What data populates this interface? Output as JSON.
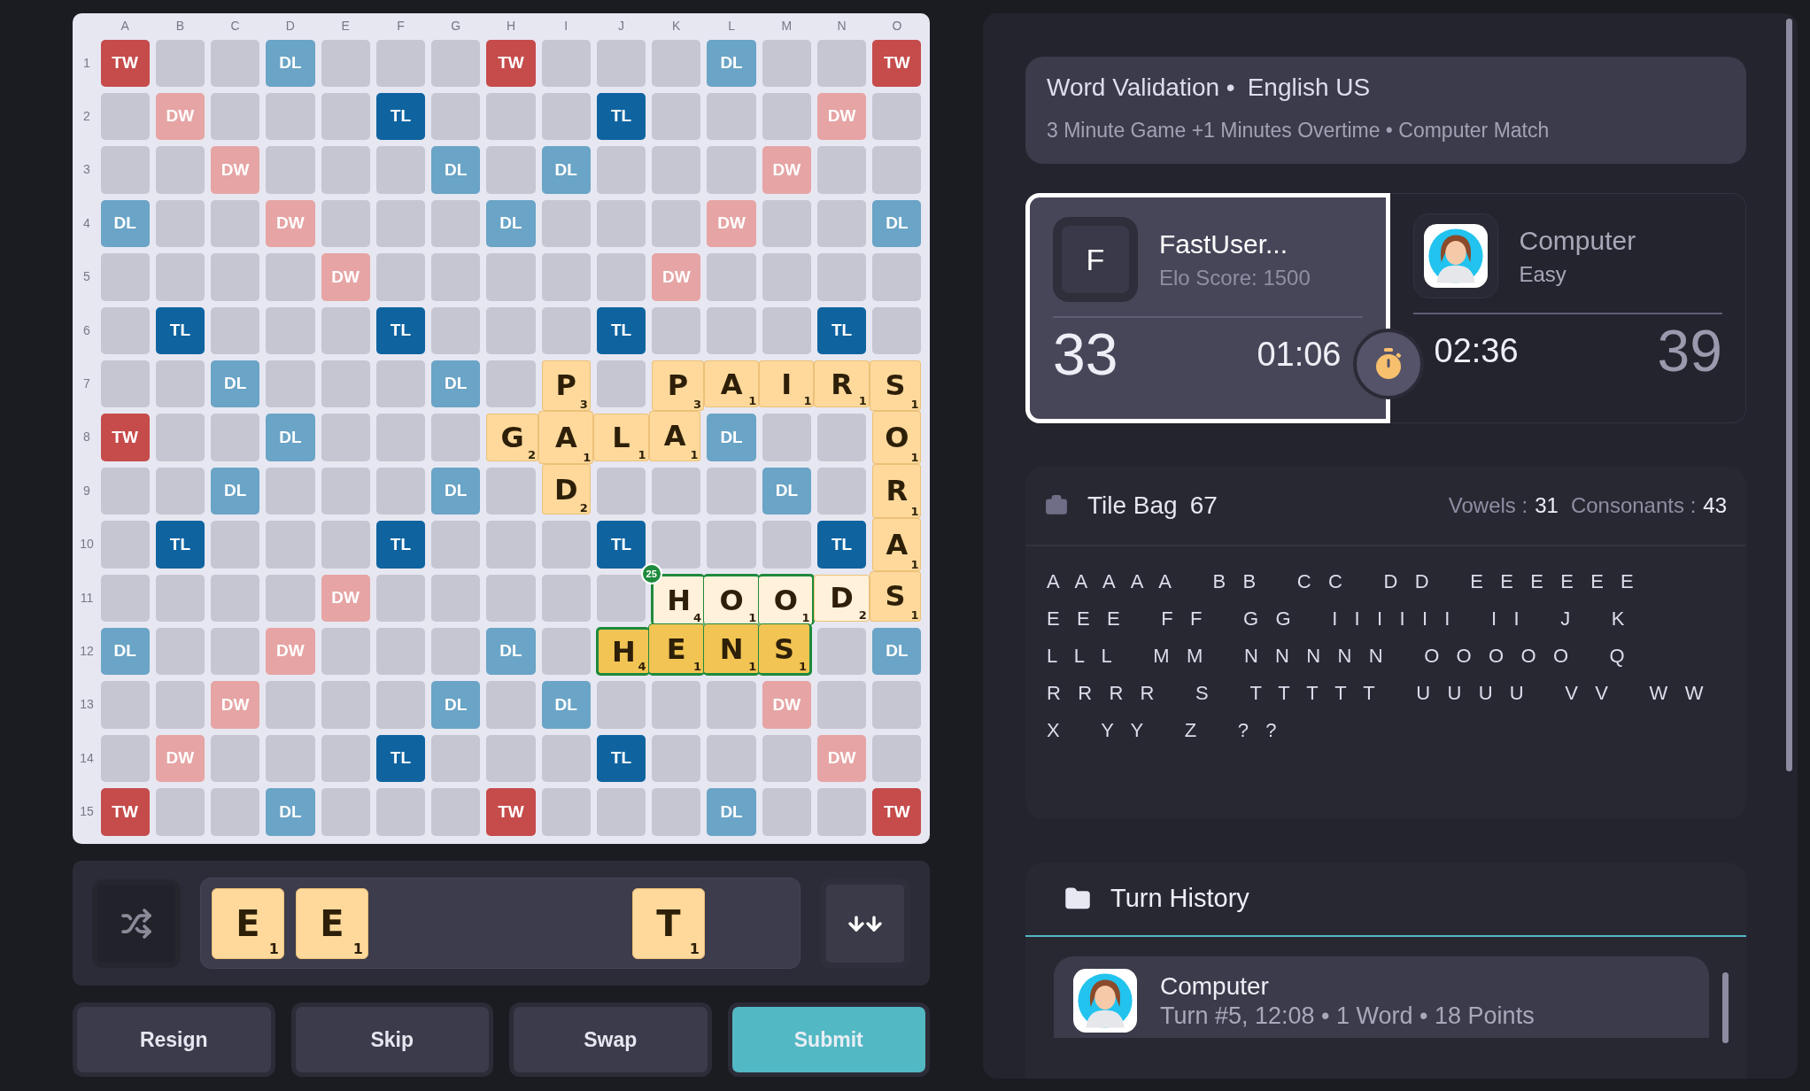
{
  "board": {
    "columns": [
      "A",
      "B",
      "C",
      "D",
      "E",
      "F",
      "G",
      "H",
      "I",
      "J",
      "K",
      "L",
      "M",
      "N",
      "O"
    ],
    "rows": [
      {
        "label": "1",
        "cells": [
          {
            "kind": "tw",
            "label": "TW"
          },
          {
            "kind": "empty"
          },
          {
            "kind": "empty"
          },
          {
            "kind": "dl",
            "label": "DL"
          },
          {
            "kind": "empty"
          },
          {
            "kind": "empty"
          },
          {
            "kind": "empty"
          },
          {
            "kind": "tw",
            "label": "TW"
          },
          {
            "kind": "empty"
          },
          {
            "kind": "empty"
          },
          {
            "kind": "empty"
          },
          {
            "kind": "dl",
            "label": "DL"
          },
          {
            "kind": "empty"
          },
          {
            "kind": "empty"
          },
          {
            "kind": "tw",
            "label": "TW"
          }
        ]
      },
      {
        "label": "2",
        "cells": [
          {
            "kind": "empty"
          },
          {
            "kind": "dw",
            "label": "DW"
          },
          {
            "kind": "empty"
          },
          {
            "kind": "empty"
          },
          {
            "kind": "empty"
          },
          {
            "kind": "tl",
            "label": "TL"
          },
          {
            "kind": "empty"
          },
          {
            "kind": "empty"
          },
          {
            "kind": "empty"
          },
          {
            "kind": "tl",
            "label": "TL"
          },
          {
            "kind": "empty"
          },
          {
            "kind": "empty"
          },
          {
            "kind": "empty"
          },
          {
            "kind": "dw",
            "label": "DW"
          },
          {
            "kind": "empty"
          }
        ]
      },
      {
        "label": "3",
        "cells": [
          {
            "kind": "empty"
          },
          {
            "kind": "empty"
          },
          {
            "kind": "dw",
            "label": "DW"
          },
          {
            "kind": "empty"
          },
          {
            "kind": "empty"
          },
          {
            "kind": "empty"
          },
          {
            "kind": "dl",
            "label": "DL"
          },
          {
            "kind": "empty"
          },
          {
            "kind": "dl",
            "label": "DL"
          },
          {
            "kind": "empty"
          },
          {
            "kind": "empty"
          },
          {
            "kind": "empty"
          },
          {
            "kind": "dw",
            "label": "DW"
          },
          {
            "kind": "empty"
          },
          {
            "kind": "empty"
          }
        ]
      },
      {
        "label": "4",
        "cells": [
          {
            "kind": "dl",
            "label": "DL"
          },
          {
            "kind": "empty"
          },
          {
            "kind": "empty"
          },
          {
            "kind": "dw",
            "label": "DW"
          },
          {
            "kind": "empty"
          },
          {
            "kind": "empty"
          },
          {
            "kind": "empty"
          },
          {
            "kind": "dl",
            "label": "DL"
          },
          {
            "kind": "empty"
          },
          {
            "kind": "empty"
          },
          {
            "kind": "empty"
          },
          {
            "kind": "dw",
            "label": "DW"
          },
          {
            "kind": "empty"
          },
          {
            "kind": "empty"
          },
          {
            "kind": "dl",
            "label": "DL"
          }
        ]
      },
      {
        "label": "5",
        "cells": [
          {
            "kind": "empty"
          },
          {
            "kind": "empty"
          },
          {
            "kind": "empty"
          },
          {
            "kind": "empty"
          },
          {
            "kind": "dw",
            "label": "DW"
          },
          {
            "kind": "empty"
          },
          {
            "kind": "empty"
          },
          {
            "kind": "empty"
          },
          {
            "kind": "empty"
          },
          {
            "kind": "empty"
          },
          {
            "kind": "dw",
            "label": "DW"
          },
          {
            "kind": "empty"
          },
          {
            "kind": "empty"
          },
          {
            "kind": "empty"
          },
          {
            "kind": "empty"
          }
        ]
      },
      {
        "label": "6",
        "cells": [
          {
            "kind": "empty"
          },
          {
            "kind": "tl",
            "label": "TL"
          },
          {
            "kind": "empty"
          },
          {
            "kind": "empty"
          },
          {
            "kind": "empty"
          },
          {
            "kind": "tl",
            "label": "TL"
          },
          {
            "kind": "empty"
          },
          {
            "kind": "empty"
          },
          {
            "kind": "empty"
          },
          {
            "kind": "tl",
            "label": "TL"
          },
          {
            "kind": "empty"
          },
          {
            "kind": "empty"
          },
          {
            "kind": "empty"
          },
          {
            "kind": "tl",
            "label": "TL"
          },
          {
            "kind": "empty"
          }
        ]
      },
      {
        "label": "7",
        "cells": [
          {
            "kind": "empty"
          },
          {
            "kind": "empty"
          },
          {
            "kind": "dl",
            "label": "DL"
          },
          {
            "kind": "empty"
          },
          {
            "kind": "empty"
          },
          {
            "kind": "empty"
          },
          {
            "kind": "dl",
            "label": "DL"
          },
          {
            "kind": "empty"
          },
          {
            "kind": "tile",
            "letter": "P",
            "points": "3",
            "pending": false,
            "last_move": false,
            "outlined": false
          },
          {
            "kind": "empty"
          },
          {
            "kind": "tile",
            "letter": "P",
            "points": "3",
            "pending": false,
            "last_move": false,
            "outlined": false
          },
          {
            "kind": "tile",
            "letter": "A",
            "points": "1",
            "pending": false,
            "last_move": false,
            "outlined": false
          },
          {
            "kind": "tile",
            "letter": "I",
            "points": "1",
            "pending": false,
            "last_move": false,
            "outlined": false
          },
          {
            "kind": "tile",
            "letter": "R",
            "points": "1",
            "pending": false,
            "last_move": false,
            "outlined": false
          },
          {
            "kind": "tile",
            "letter": "S",
            "points": "1",
            "pending": false,
            "last_move": false,
            "outlined": false
          }
        ]
      },
      {
        "label": "8",
        "cells": [
          {
            "kind": "tw",
            "label": "TW"
          },
          {
            "kind": "empty"
          },
          {
            "kind": "empty"
          },
          {
            "kind": "dl",
            "label": "DL"
          },
          {
            "kind": "empty"
          },
          {
            "kind": "empty"
          },
          {
            "kind": "empty"
          },
          {
            "kind": "tile",
            "letter": "G",
            "points": "2",
            "pending": false,
            "last_move": false,
            "outlined": false
          },
          {
            "kind": "tile",
            "letter": "A",
            "points": "1",
            "pending": false,
            "last_move": false,
            "outlined": false
          },
          {
            "kind": "tile",
            "letter": "L",
            "points": "1",
            "pending": false,
            "last_move": false,
            "outlined": false
          },
          {
            "kind": "tile",
            "letter": "A",
            "points": "1",
            "pending": false,
            "last_move": false,
            "outlined": false
          },
          {
            "kind": "dl",
            "label": "DL"
          },
          {
            "kind": "empty"
          },
          {
            "kind": "empty"
          },
          {
            "kind": "tile",
            "letter": "O",
            "points": "1",
            "pending": false,
            "last_move": false,
            "outlined": false
          }
        ]
      },
      {
        "label": "9",
        "cells": [
          {
            "kind": "empty"
          },
          {
            "kind": "empty"
          },
          {
            "kind": "dl",
            "label": "DL"
          },
          {
            "kind": "empty"
          },
          {
            "kind": "empty"
          },
          {
            "kind": "empty"
          },
          {
            "kind": "dl",
            "label": "DL"
          },
          {
            "kind": "empty"
          },
          {
            "kind": "tile",
            "letter": "D",
            "points": "2",
            "pending": false,
            "last_move": false,
            "outlined": false
          },
          {
            "kind": "empty"
          },
          {
            "kind": "empty"
          },
          {
            "kind": "empty"
          },
          {
            "kind": "dl",
            "label": "DL"
          },
          {
            "kind": "empty"
          },
          {
            "kind": "tile",
            "letter": "R",
            "points": "1",
            "pending": false,
            "last_move": false,
            "outlined": false
          }
        ]
      },
      {
        "label": "10",
        "cells": [
          {
            "kind": "empty"
          },
          {
            "kind": "tl",
            "label": "TL"
          },
          {
            "kind": "empty"
          },
          {
            "kind": "empty"
          },
          {
            "kind": "empty"
          },
          {
            "kind": "tl",
            "label": "TL"
          },
          {
            "kind": "empty"
          },
          {
            "kind": "empty"
          },
          {
            "kind": "empty"
          },
          {
            "kind": "tl",
            "label": "TL"
          },
          {
            "kind": "empty"
          },
          {
            "kind": "empty"
          },
          {
            "kind": "empty"
          },
          {
            "kind": "tl",
            "label": "TL"
          },
          {
            "kind": "tile",
            "letter": "A",
            "points": "1",
            "pending": false,
            "last_move": false,
            "outlined": false
          }
        ]
      },
      {
        "label": "11",
        "cells": [
          {
            "kind": "empty"
          },
          {
            "kind": "empty"
          },
          {
            "kind": "empty"
          },
          {
            "kind": "empty"
          },
          {
            "kind": "dw",
            "label": "DW"
          },
          {
            "kind": "empty"
          },
          {
            "kind": "empty"
          },
          {
            "kind": "empty"
          },
          {
            "kind": "empty"
          },
          {
            "kind": "empty"
          },
          {
            "kind": "tile",
            "letter": "H",
            "points": "4",
            "pending": false,
            "last_move": true,
            "outlined": true,
            "badge": "25"
          },
          {
            "kind": "tile",
            "letter": "O",
            "points": "1",
            "pending": false,
            "last_move": true,
            "outlined": true
          },
          {
            "kind": "tile",
            "letter": "O",
            "points": "1",
            "pending": false,
            "last_move": true,
            "outlined": true
          },
          {
            "kind": "tile",
            "letter": "D",
            "points": "2",
            "pending": false,
            "last_move": true,
            "outlined": false
          },
          {
            "kind": "tile",
            "letter": "S",
            "points": "1",
            "pending": false,
            "last_move": false,
            "outlined": false
          }
        ]
      },
      {
        "label": "12",
        "cells": [
          {
            "kind": "dl",
            "label": "DL"
          },
          {
            "kind": "empty"
          },
          {
            "kind": "empty"
          },
          {
            "kind": "dw",
            "label": "DW"
          },
          {
            "kind": "empty"
          },
          {
            "kind": "empty"
          },
          {
            "kind": "empty"
          },
          {
            "kind": "dl",
            "label": "DL"
          },
          {
            "kind": "empty"
          },
          {
            "kind": "tile",
            "letter": "H",
            "points": "4",
            "pending": true,
            "last_move": false,
            "outlined": true
          },
          {
            "kind": "tile",
            "letter": "E",
            "points": "1",
            "pending": true,
            "last_move": false,
            "outlined": true
          },
          {
            "kind": "tile",
            "letter": "N",
            "points": "1",
            "pending": true,
            "last_move": false,
            "outlined": true
          },
          {
            "kind": "tile",
            "letter": "S",
            "points": "1",
            "pending": true,
            "last_move": false,
            "outlined": true
          },
          {
            "kind": "empty"
          },
          {
            "kind": "dl",
            "label": "DL"
          }
        ]
      },
      {
        "label": "13",
        "cells": [
          {
            "kind": "empty"
          },
          {
            "kind": "empty"
          },
          {
            "kind": "dw",
            "label": "DW"
          },
          {
            "kind": "empty"
          },
          {
            "kind": "empty"
          },
          {
            "kind": "empty"
          },
          {
            "kind": "dl",
            "label": "DL"
          },
          {
            "kind": "empty"
          },
          {
            "kind": "dl",
            "label": "DL"
          },
          {
            "kind": "empty"
          },
          {
            "kind": "empty"
          },
          {
            "kind": "empty"
          },
          {
            "kind": "dw",
            "label": "DW"
          },
          {
            "kind": "empty"
          },
          {
            "kind": "empty"
          }
        ]
      },
      {
        "label": "14",
        "cells": [
          {
            "kind": "empty"
          },
          {
            "kind": "dw",
            "label": "DW"
          },
          {
            "kind": "empty"
          },
          {
            "kind": "empty"
          },
          {
            "kind": "empty"
          },
          {
            "kind": "tl",
            "label": "TL"
          },
          {
            "kind": "empty"
          },
          {
            "kind": "empty"
          },
          {
            "kind": "empty"
          },
          {
            "kind": "tl",
            "label": "TL"
          },
          {
            "kind": "empty"
          },
          {
            "kind": "empty"
          },
          {
            "kind": "empty"
          },
          {
            "kind": "dw",
            "label": "DW"
          },
          {
            "kind": "empty"
          }
        ]
      },
      {
        "label": "15",
        "cells": [
          {
            "kind": "tw",
            "label": "TW"
          },
          {
            "kind": "empty"
          },
          {
            "kind": "empty"
          },
          {
            "kind": "dl",
            "label": "DL"
          },
          {
            "kind": "empty"
          },
          {
            "kind": "empty"
          },
          {
            "kind": "empty"
          },
          {
            "kind": "tw",
            "label": "TW"
          },
          {
            "kind": "empty"
          },
          {
            "kind": "empty"
          },
          {
            "kind": "empty"
          },
          {
            "kind": "dl",
            "label": "DL"
          },
          {
            "kind": "empty"
          },
          {
            "kind": "empty"
          },
          {
            "kind": "tw",
            "label": "TW"
          }
        ]
      }
    ]
  },
  "rack": {
    "slots": [
      {
        "kind": "tile",
        "letter": "E",
        "points": "1"
      },
      {
        "kind": "tile",
        "letter": "E",
        "points": "1"
      },
      {
        "kind": "empty"
      },
      {
        "kind": "empty"
      },
      {
        "kind": "empty"
      },
      {
        "kind": "tile",
        "letter": "T",
        "points": "1"
      },
      {
        "kind": "empty"
      }
    ]
  },
  "actions": [
    {
      "label": "Resign",
      "primary": false
    },
    {
      "label": "Skip",
      "primary": false
    },
    {
      "label": "Swap",
      "primary": false
    },
    {
      "label": "Submit",
      "primary": true
    }
  ],
  "game_info": {
    "title": "Word Validation •",
    "language": "English US",
    "details": "3 Minute Game +1 Minutes Overtime • Computer Match"
  },
  "players": [
    {
      "name": "FastUser...",
      "subtitle": "Elo Score: 1500",
      "avatar": {
        "kind": "letter",
        "letter": "F"
      },
      "score": "33",
      "time": "01:06",
      "active": true
    },
    {
      "name": "Computer",
      "subtitle": "Easy",
      "avatar": {
        "kind": "picture"
      },
      "score": "39",
      "time": "02:36",
      "active": false
    }
  ],
  "tile_bag": {
    "title": "Tile Bag",
    "count": "67",
    "vowels_label": "Vowels :",
    "vowels": "31",
    "consonants_label": "Consonants :",
    "consonants": "43",
    "lines": [
      [
        "A A A A A",
        "B B",
        "C C",
        "D D",
        "E E E E E E"
      ],
      [
        "E E E",
        "F F",
        "G G",
        "I I I I I I",
        "I I",
        "J",
        "K"
      ],
      [
        "L L L",
        "M M",
        "N N N N N",
        "O O O O O",
        "Q"
      ],
      [
        "R R R R",
        "S",
        "T T T T T",
        "U U U U",
        "V V",
        "W W"
      ],
      [
        "X",
        "Y Y",
        "Z",
        "? ?"
      ]
    ]
  },
  "turn_history": {
    "title": "Turn History",
    "items": [
      {
        "player": "Computer",
        "details": "Turn #5, 12:08 • 1 Word • 18 Points"
      }
    ]
  }
}
